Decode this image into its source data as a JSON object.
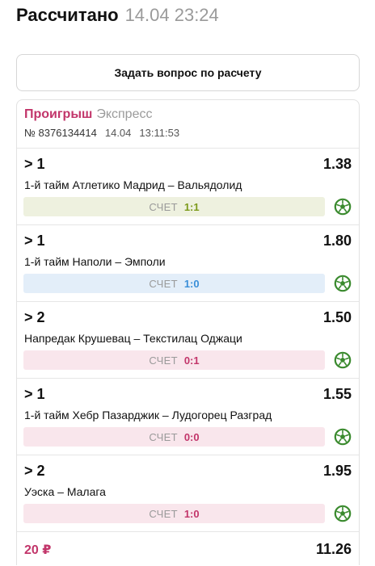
{
  "header": {
    "title": "Рассчитано",
    "timestamp": "14.04 23:24"
  },
  "ask_button": "Задать вопрос по расчету",
  "bet": {
    "status": "Проигрыш",
    "type": "Экспресс",
    "number": "№ 8376134414",
    "date": "14.04",
    "time": "13:11:53"
  },
  "selections": [
    {
      "outcome": "> 1",
      "odds": "1.38",
      "match": "1-й тайм Атлетико Мадрид – Вальядолид",
      "score_label": "СЧЕТ",
      "score": "1:1",
      "bg": "#eef1df",
      "score_color": "#7c9a1a"
    },
    {
      "outcome": "> 1",
      "odds": "1.80",
      "match": "1-й тайм Наполи – Эмполи",
      "score_label": "СЧЕТ",
      "score": "1:0",
      "bg": "#e3eef9",
      "score_color": "#3a8fd8"
    },
    {
      "outcome": "> 2",
      "odds": "1.50",
      "match": "Напредак Крушевац – Текстилац Оджаци",
      "score_label": "СЧЕТ",
      "score": "0:1",
      "bg": "#f9e6ec",
      "score_color": "#c2356a"
    },
    {
      "outcome": "> 1",
      "odds": "1.55",
      "match": "1-й тайм Хебр Пазарджик – Лудогорец Разград",
      "score_label": "СЧЕТ",
      "score": "0:0",
      "bg": "#f9e6ec",
      "score_color": "#c2356a"
    },
    {
      "outcome": "> 2",
      "odds": "1.95",
      "match": "Уэска – Малага",
      "score_label": "СЧЕТ",
      "score": "1:0",
      "bg": "#f9e6ec",
      "score_color": "#c2356a"
    }
  ],
  "footer": {
    "stake": "20 ₽",
    "total_odds": "11.26"
  },
  "colors": {
    "loss": "#c2356a",
    "ball": "#3a8a2e"
  },
  "icons": {
    "sport": "football-icon"
  }
}
